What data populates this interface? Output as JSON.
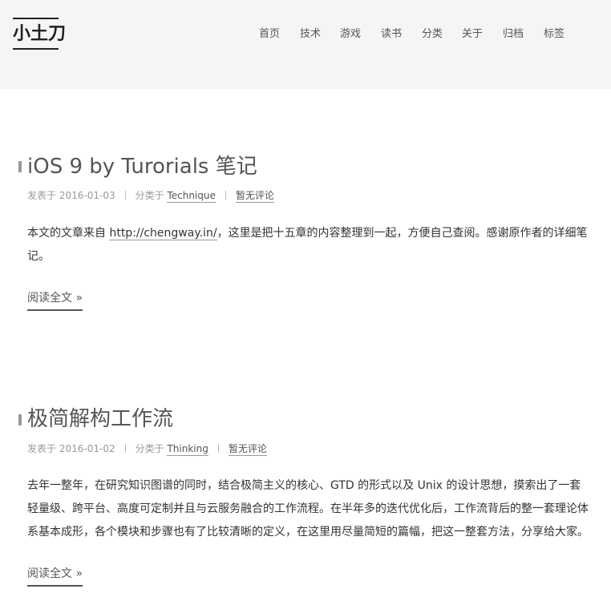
{
  "site": {
    "logo": "小土刀"
  },
  "nav": [
    {
      "label": "首页"
    },
    {
      "label": "技术"
    },
    {
      "label": "游戏"
    },
    {
      "label": "读书"
    },
    {
      "label": "分类"
    },
    {
      "label": "关于"
    },
    {
      "label": "归档"
    },
    {
      "label": "标签"
    }
  ],
  "posts": [
    {
      "title": "iOS 9 by Turorials 笔记",
      "posted_prefix": "发表于",
      "date": "2016-01-03",
      "category_prefix": "分类于",
      "category": "Technique",
      "comments": "暂无评论",
      "body_before": "本文的文章来自 ",
      "body_link": "http://chengway.in/",
      "body_after": "，这里是把十五章的内容整理到一起，方便自己查阅。感谢原作者的详细笔记。",
      "read_more": "阅读全文 »"
    },
    {
      "title": "极简解构工作流",
      "posted_prefix": "发表于",
      "date": "2016-01-02",
      "category_prefix": "分类于",
      "category": "Thinking",
      "comments": "暂无评论",
      "body": "去年一整年，在研究知识图谱的同时，结合极简主义的核心、GTD 的形式以及 Unix 的设计思想，摸索出了一套轻量级、跨平台、高度可定制并且与云服务融合的工作流程。在半年多的迭代优化后，工作流背后的整一套理论体系基本成形，各个模块和步骤也有了比较清晰的定义，在这里用尽量简短的篇幅，把这一整套方法，分享给大家。",
      "read_more": "阅读全文 »"
    }
  ]
}
